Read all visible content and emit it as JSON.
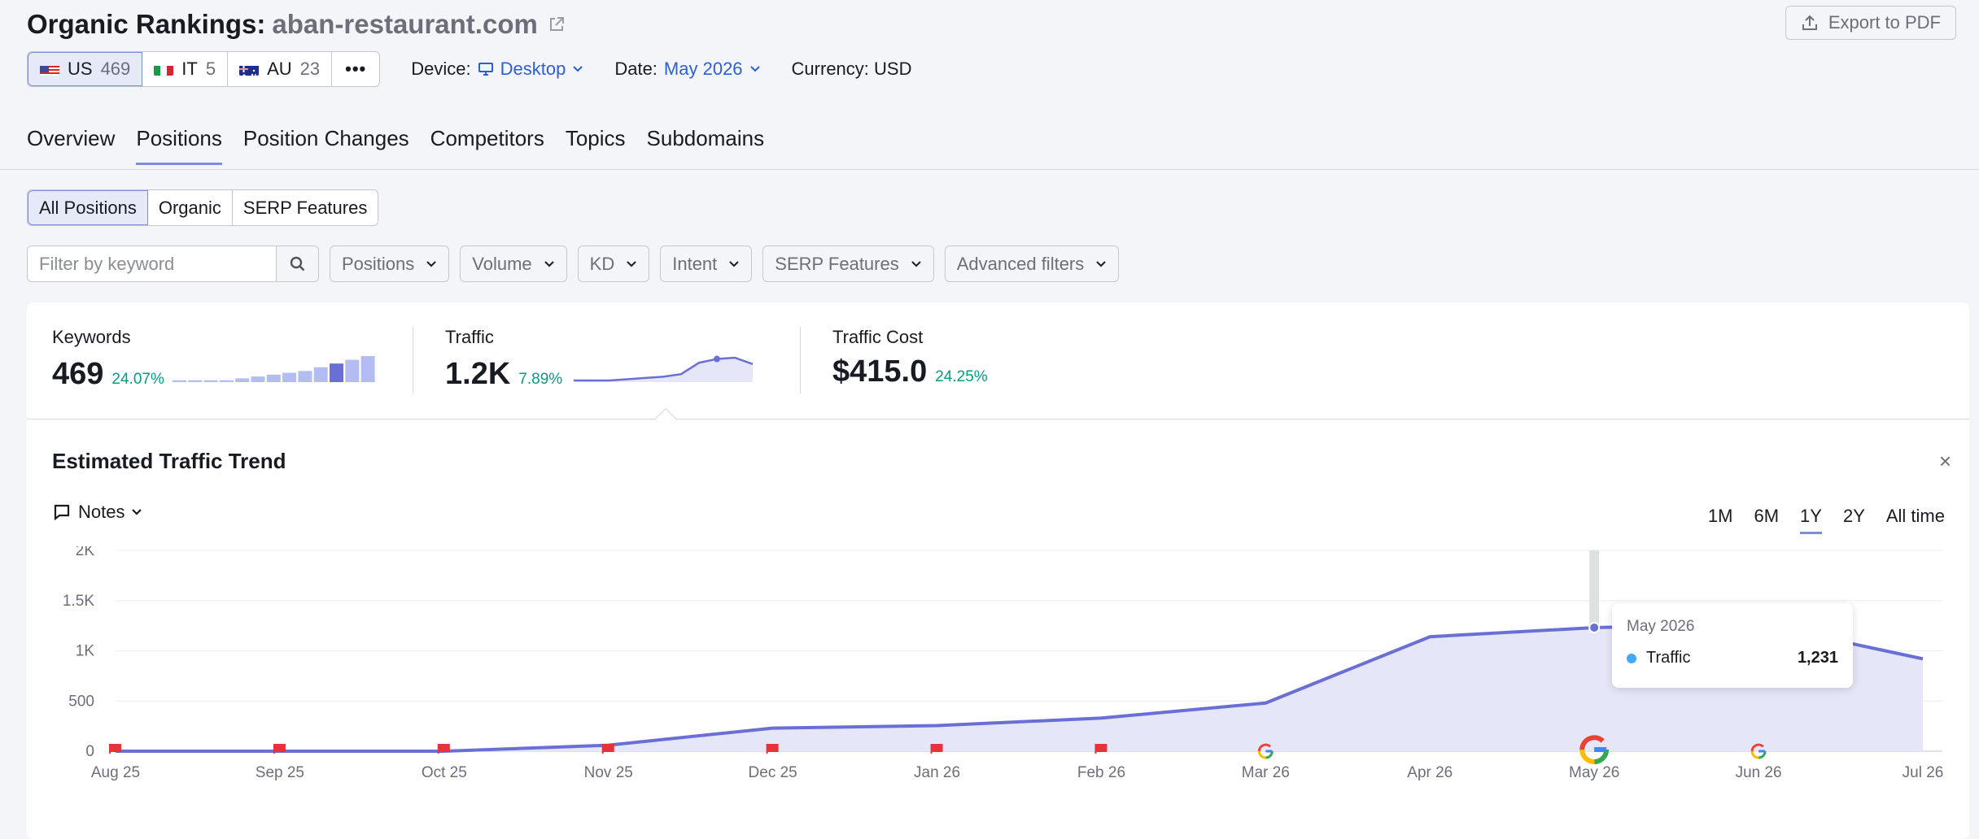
{
  "header": {
    "title": "Organic Rankings:",
    "domain": "aban-restaurant.com",
    "export_label": "Export to PDF"
  },
  "databases": [
    {
      "code": "US",
      "count": "469",
      "flag": "us-flag-icon"
    },
    {
      "code": "IT",
      "count": "5",
      "flag": "it-flag-icon"
    },
    {
      "code": "AU",
      "count": "23",
      "flag": "au-flag-icon"
    }
  ],
  "more_label": "•••",
  "device": {
    "label": "Device:",
    "value": "Desktop"
  },
  "date": {
    "label": "Date:",
    "value": "May 2026"
  },
  "currency": {
    "label": "Currency: USD"
  },
  "tabs": [
    "Overview",
    "Positions",
    "Position Changes",
    "Competitors",
    "Topics",
    "Subdomains"
  ],
  "segments": [
    "All Positions",
    "Organic",
    "SERP Features"
  ],
  "filters": {
    "search_placeholder": "Filter by keyword",
    "dropdowns": [
      "Positions",
      "Volume",
      "KD",
      "Intent",
      "SERP Features",
      "Advanced filters"
    ]
  },
  "metrics": [
    {
      "label": "Keywords",
      "value": "469",
      "change": "24.07%"
    },
    {
      "label": "Traffic",
      "value": "1.2K",
      "change": "7.89%"
    },
    {
      "label": "Traffic Cost",
      "value": "$415.0",
      "change": "24.25%"
    }
  ],
  "trend": {
    "title": "Estimated Traffic Trend",
    "close": "×",
    "notes_label": "Notes",
    "ranges": [
      "1M",
      "6M",
      "1Y",
      "2Y",
      "All time"
    ],
    "active_range": "1Y"
  },
  "tooltip": {
    "date": "May 2026",
    "series": "Traffic",
    "value": "1,231"
  },
  "colors": {
    "accent": "#6a6fd6",
    "area": "#e5e6f8",
    "positive": "#009f81",
    "link": "#2b5fd9"
  },
  "chart_data": {
    "type": "area",
    "x": [
      "Aug 25",
      "Sep 25",
      "Oct 25",
      "Nov 25",
      "Dec 25",
      "Jan 26",
      "Feb 26",
      "Mar 26",
      "Apr 26",
      "May 26",
      "Jun 26",
      "Jul 26"
    ],
    "series": [
      {
        "name": "Traffic",
        "values": [
          0,
          0,
          0,
          60,
          230,
          255,
          330,
          480,
          1140,
          1231,
          1270,
          920
        ]
      }
    ],
    "ylim": [
      0,
      2000
    ],
    "yticks": [
      "0",
      "500",
      "1K",
      "1.5K",
      "2K"
    ],
    "grid": true,
    "note_flags": [
      "Aug 25",
      "Sep 25",
      "Oct 25",
      "Nov 25",
      "Dec 25",
      "Jan 26",
      "Feb 26"
    ],
    "google_updates": [
      "Mar 26",
      "May 26",
      "Jun 26"
    ]
  },
  "sparklines": {
    "keywords_bars": [
      1,
      1,
      1,
      1,
      2,
      3,
      4,
      5,
      6,
      8,
      10,
      12,
      14
    ],
    "traffic_line": [
      0,
      0,
      0,
      1,
      2,
      3,
      5,
      14,
      17,
      18,
      13
    ]
  }
}
